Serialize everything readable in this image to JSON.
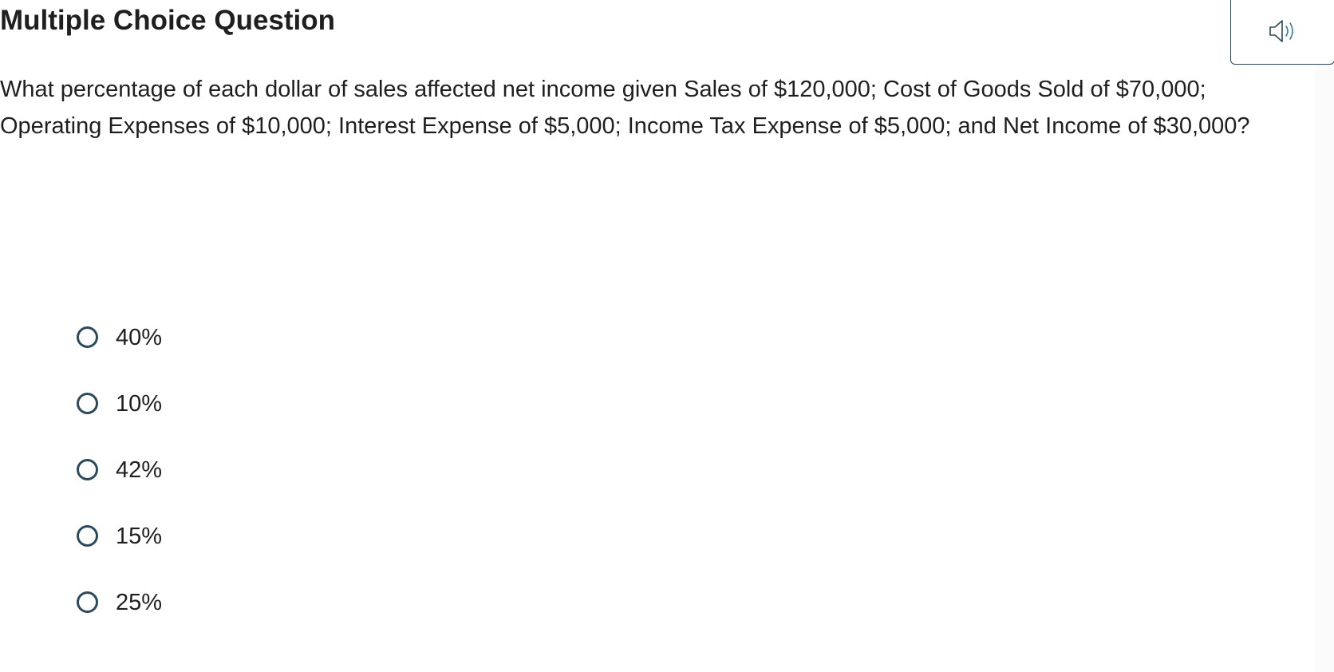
{
  "header": {
    "title": "Multiple Choice Question",
    "audio_icon": "speaker-icon"
  },
  "question": {
    "text": "What percentage of each dollar of sales affected net income given Sales of $120,000; Cost of Goods Sold of $70,000; Operating Expenses of $10,000; Interest Expense of $5,000; Income Tax Expense of $5,000; and Net Income of $30,000?"
  },
  "options": [
    {
      "label": "40%",
      "selected": false
    },
    {
      "label": "10%",
      "selected": false
    },
    {
      "label": "42%",
      "selected": false
    },
    {
      "label": "15%",
      "selected": false
    },
    {
      "label": "25%",
      "selected": false
    }
  ],
  "colors": {
    "text": "#1f1f1f",
    "radio_border": "#2c4a5c",
    "speaker_accent": "#2b7ea6"
  }
}
